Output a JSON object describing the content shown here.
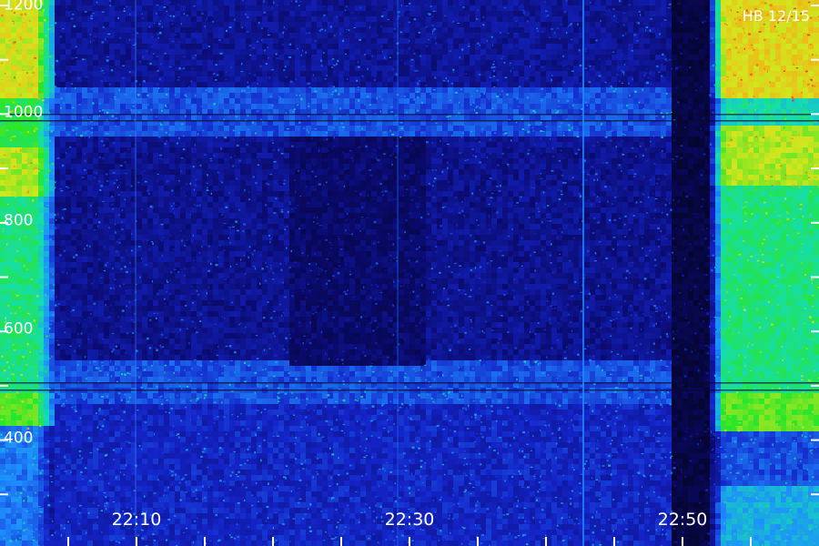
{
  "station_label": "HB 12/15",
  "colors": {
    "axis": "#ffffff",
    "colormap": [
      "#05052a",
      "#0a0a6a",
      "#1424c8",
      "#1e8cff",
      "#14dcb4",
      "#2ae62a",
      "#d2e61e",
      "#ff9a14",
      "#e61e14"
    ]
  },
  "chart_data": {
    "type": "heatmap",
    "title": "",
    "xlabel": "",
    "ylabel": "",
    "x_ticks": [
      "22:10",
      "22:30",
      "22:50"
    ],
    "y_ticks": [
      "1200",
      "1000",
      "800",
      "600",
      "400"
    ],
    "ylim": [
      250,
      1300
    ],
    "colormap": "jet",
    "legend": "none",
    "grid": false
  }
}
